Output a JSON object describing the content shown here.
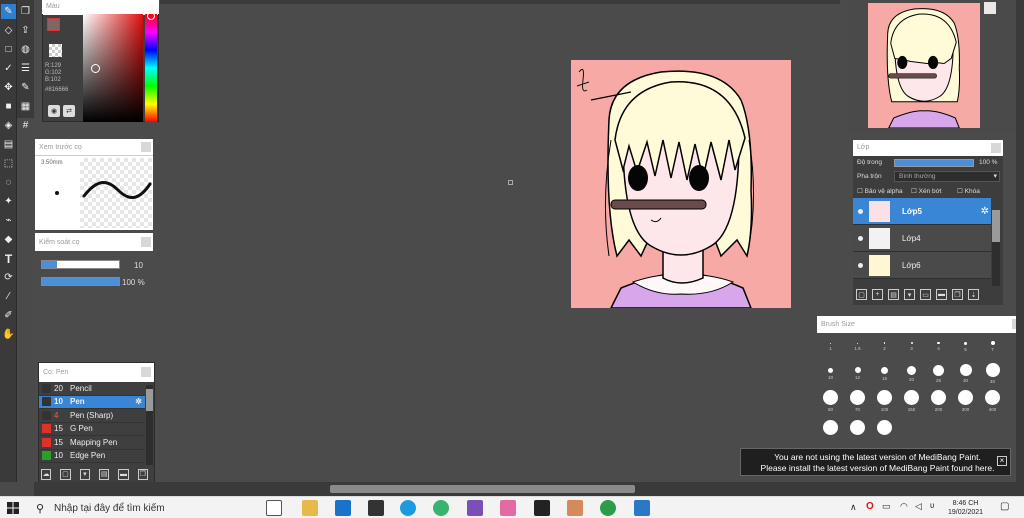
{
  "color_panel": {
    "title": "Màu",
    "r": "R:129",
    "g": "G:102",
    "b": "B:102",
    "hex": "#816666",
    "current_color": "#816666"
  },
  "preview_panel": {
    "title": "Xem trước cọ",
    "size": "3.50mm"
  },
  "control_panel": {
    "title": "Kiểm soát cọ",
    "size_value": "10",
    "opacity_value": "100 %"
  },
  "brush_panel": {
    "title": "Cọ: Pen",
    "brushes": [
      {
        "size": "20",
        "name": "Pencil",
        "color": "#333333"
      },
      {
        "size": "10",
        "name": "Pen",
        "color": "#333333"
      },
      {
        "size": "4",
        "name": "Pen (Sharp)",
        "color": "#333333"
      },
      {
        "size": "15",
        "name": "G Pen",
        "color": "#e0302a"
      },
      {
        "size": "15",
        "name": "Mapping Pen",
        "color": "#e0302a"
      },
      {
        "size": "10",
        "name": "Edge Pen",
        "color": "#2aa02a"
      }
    ]
  },
  "layer_panel": {
    "title": "Lớp",
    "opacity_label": "Độ trong",
    "opacity_value": "100 %",
    "blend_label": "Pha trộn",
    "blend_value": "Bình thường",
    "protect_alpha": "Bảo vệ alpha",
    "clipping": "Xén bớt",
    "lock": "Khóa",
    "layers": [
      "Lớp5",
      "Lớp4",
      "Lớp6"
    ]
  },
  "brush_size_panel": {
    "title": "Brush Size",
    "sizes": [
      "1",
      "1.5",
      "2",
      "3",
      "4",
      "5",
      "7",
      "10",
      "12",
      "15",
      "20",
      "25",
      "30",
      "40",
      "50",
      "70",
      "100",
      "150",
      "200",
      "300",
      "400",
      "",
      "",
      ""
    ]
  },
  "notice": {
    "line1": "You are not using the latest version of MediBang Paint.",
    "line2": "Please install the latest version of MediBang Paint found here."
  },
  "taskbar": {
    "search_placeholder": "Nhập tại đây để tìm kiếm",
    "time": "8:46 CH",
    "date": "19/02/2021"
  }
}
